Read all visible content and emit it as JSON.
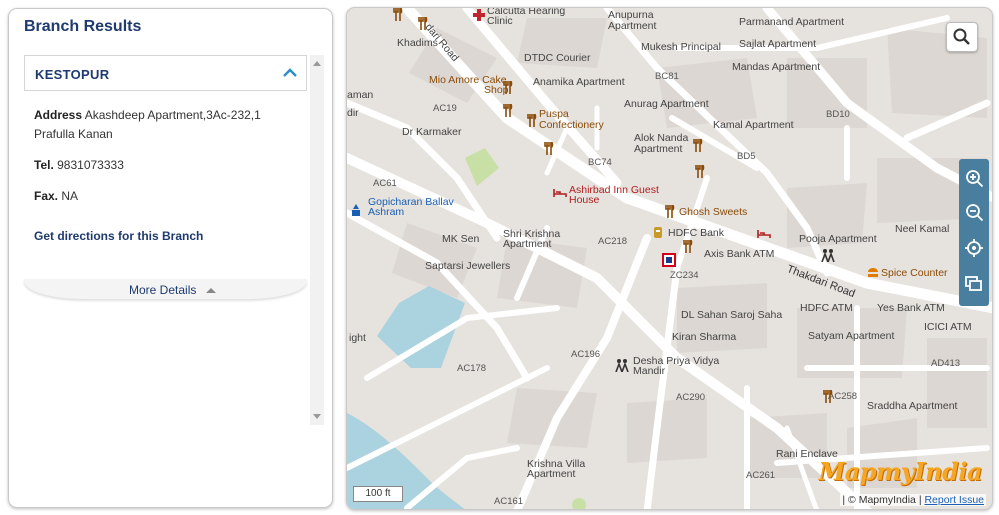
{
  "panel": {
    "title": "Branch Results",
    "branch": {
      "name": "KESTOPUR",
      "address_label": "Address",
      "address": "Akashdeep Apartment,3Ac-232,1 Prafulla Kanan",
      "tel_label": "Tel.",
      "tel": "9831073333",
      "fax_label": "Fax.",
      "fax": "NA",
      "directions_link": "Get directions for this Branch",
      "more_details": "More Details"
    }
  },
  "map": {
    "labels": {
      "khadims": "Khadims",
      "road_top": "dari Road",
      "calcutta": "Calcutta Hearing",
      "clinic": "Clinic",
      "anupurna": "Anupurna",
      "apartment_anupurna": "Apartment",
      "parmanand": "Parmanand Apartment",
      "sajlat": "Sajlat Apartment",
      "dtdc": "DTDC Courier",
      "mukesh": "Mukesh Principal",
      "mandas": "Mandas Apartment",
      "mio1": "Mio Amore Cake",
      "mio2": "Shop",
      "anamika": "Anamika Apartment",
      "bc81": "BC81",
      "aman": "aman",
      "dir": "dir",
      "ac19": "AC19",
      "puspa1": "Puspa",
      "puspa2": "Confectionery",
      "anurag": "Anurag Apartment",
      "bd10": "BD10",
      "karmaker": "Dr Karmaker",
      "kamal": "Kamal Apartment",
      "alok1": "Alok Nanda",
      "alok2": "Apartment",
      "bc74": "BC74",
      "bd5": "BD5",
      "ac61": "AC61",
      "ashirbad1": "Ashirbad Inn Guest",
      "ashirbad2": "House",
      "ghosh": "Ghosh Sweets",
      "gopi1": "Gopicharan Ballav",
      "gopi2": "Ashram",
      "hdfc": "HDFC Bank",
      "neel": "Neel Kamal",
      "mksen": "MK Sen",
      "shri1": "Shri Krishna",
      "shri2": "Apartment",
      "ac218": "AC218",
      "axis": "Axis Bank ATM",
      "pooja": "Pooja Apartment",
      "thakdari": "Thakdari Road",
      "saptarsi": "Saptarsi Jewellers",
      "zc234": "ZC234",
      "spice": "Spice Counter",
      "dlsahan": "DL Sahan Saroj Saha",
      "hdfcatm": "HDFC ATM",
      "yesatm": "Yes Bank ATM",
      "ight": "ight",
      "kiran": "Kiran Sharma",
      "satyam": "Satyam Apartment",
      "icici": "ICICI ATM",
      "ac196": "AC196",
      "desha1": "Desha Priya Vidya",
      "desha2": "Mandir",
      "ad413": "AD413",
      "ac178": "AC178",
      "ac290": "AC290",
      "ac258": "AC258",
      "sraddha": "Sraddha Apartment",
      "rani": "Rani Enclave",
      "ac261": "AC261",
      "krishna1": "Krishna Villa",
      "krishna2": "Apartment",
      "ac161": "AC161"
    },
    "scale": "100 ft",
    "brand": "MapmyIndia",
    "attribution_prefix": "| © MapmyIndia |",
    "report_issue": "Report Issue",
    "colors": {
      "land": "#e6e2de",
      "road": "#ffffff",
      "water": "#aad3df",
      "park": "#c8e0a5",
      "control": "#4a7e9e"
    },
    "icons": [
      "search-icon",
      "zoom-in-icon",
      "zoom-out-icon",
      "locate-icon",
      "layers-icon",
      "restaurant-icon",
      "hospital-icon",
      "hotel-icon",
      "bank-icon",
      "school-icon",
      "temple-icon",
      "fastfood-icon",
      "branch-marker-icon"
    ]
  }
}
